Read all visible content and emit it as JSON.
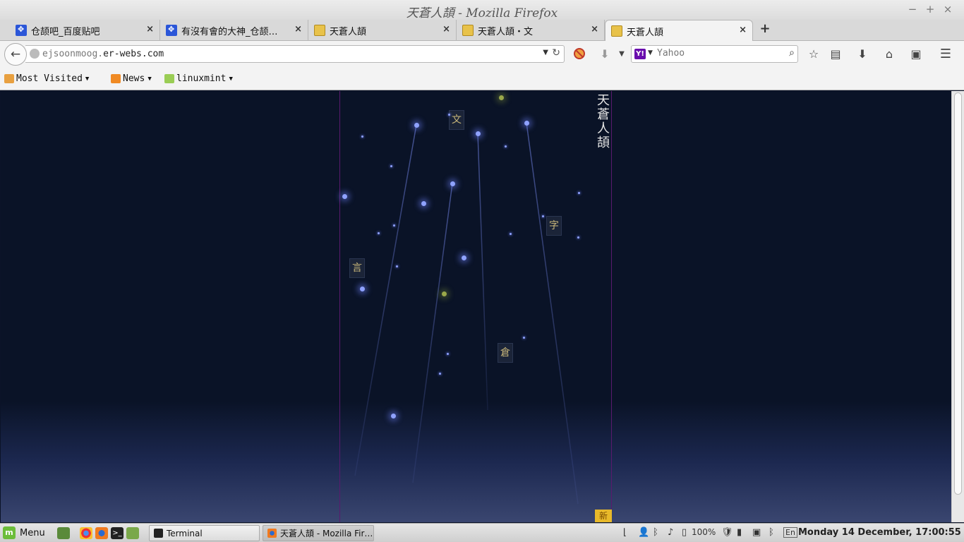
{
  "window": {
    "title": "天蒼人頡 - Mozilla Firefox",
    "minimize": "−",
    "maximize": "+",
    "close": "×"
  },
  "tabs": [
    {
      "label": "仓颉吧_百度贴吧",
      "icon": "baidu-paw-icon"
    },
    {
      "label": "有沒有會的大神_仓颉…",
      "icon": "baidu-paw-icon"
    },
    {
      "label": "天蒼人頡",
      "icon": "seal-icon"
    },
    {
      "label": "天蒼人頡・文",
      "icon": "seal-icon"
    },
    {
      "label": "天蒼人頡",
      "icon": "seal-icon",
      "active": true
    }
  ],
  "tab_close": "×",
  "new_tab": "+",
  "navbar": {
    "back": "←",
    "url_dim": "ejsoonmoog.",
    "url_main": "er-webs.com",
    "url_dropdown": "▼",
    "reload": "↻",
    "search_engine": "Y!",
    "search_placeholder": "Yahoo",
    "search_go": "⌕",
    "icons": [
      "adblock-icon",
      "download-arrow-icon",
      "dropdown-icon",
      "bookmark-star-icon",
      "reading-list-icon",
      "downloads-icon",
      "home-icon",
      "pocket-icon",
      "menu-hamburger-icon"
    ]
  },
  "bookmarks": [
    {
      "label": "Most Visited",
      "icon": "most-visited-icon"
    },
    {
      "label": "News",
      "icon": "rss-icon"
    },
    {
      "label": "linuxmint",
      "icon": "folder-icon"
    }
  ],
  "page": {
    "vertical_title": [
      "天",
      "蒼",
      "人",
      "頡"
    ],
    "seal_corner": "新",
    "glyphs": [
      "文",
      "字",
      "言",
      "倉"
    ]
  },
  "taskbar": {
    "menu_label": "Menu",
    "tasks": [
      {
        "label": "Terminal",
        "icon": "terminal-icon"
      },
      {
        "label": "天蒼人頡 - Mozilla Fir…",
        "icon": "firefox-icon",
        "active": true
      }
    ],
    "battery": "100%",
    "keyboard_layout": "En",
    "clock": "Monday 14 December, 17:00:55"
  },
  "colors": {
    "page_background": "#0a1327",
    "panel_border": "#5a1a6e",
    "star_blue": "#8fa2ff",
    "seal_gold": "#e8b92a"
  }
}
